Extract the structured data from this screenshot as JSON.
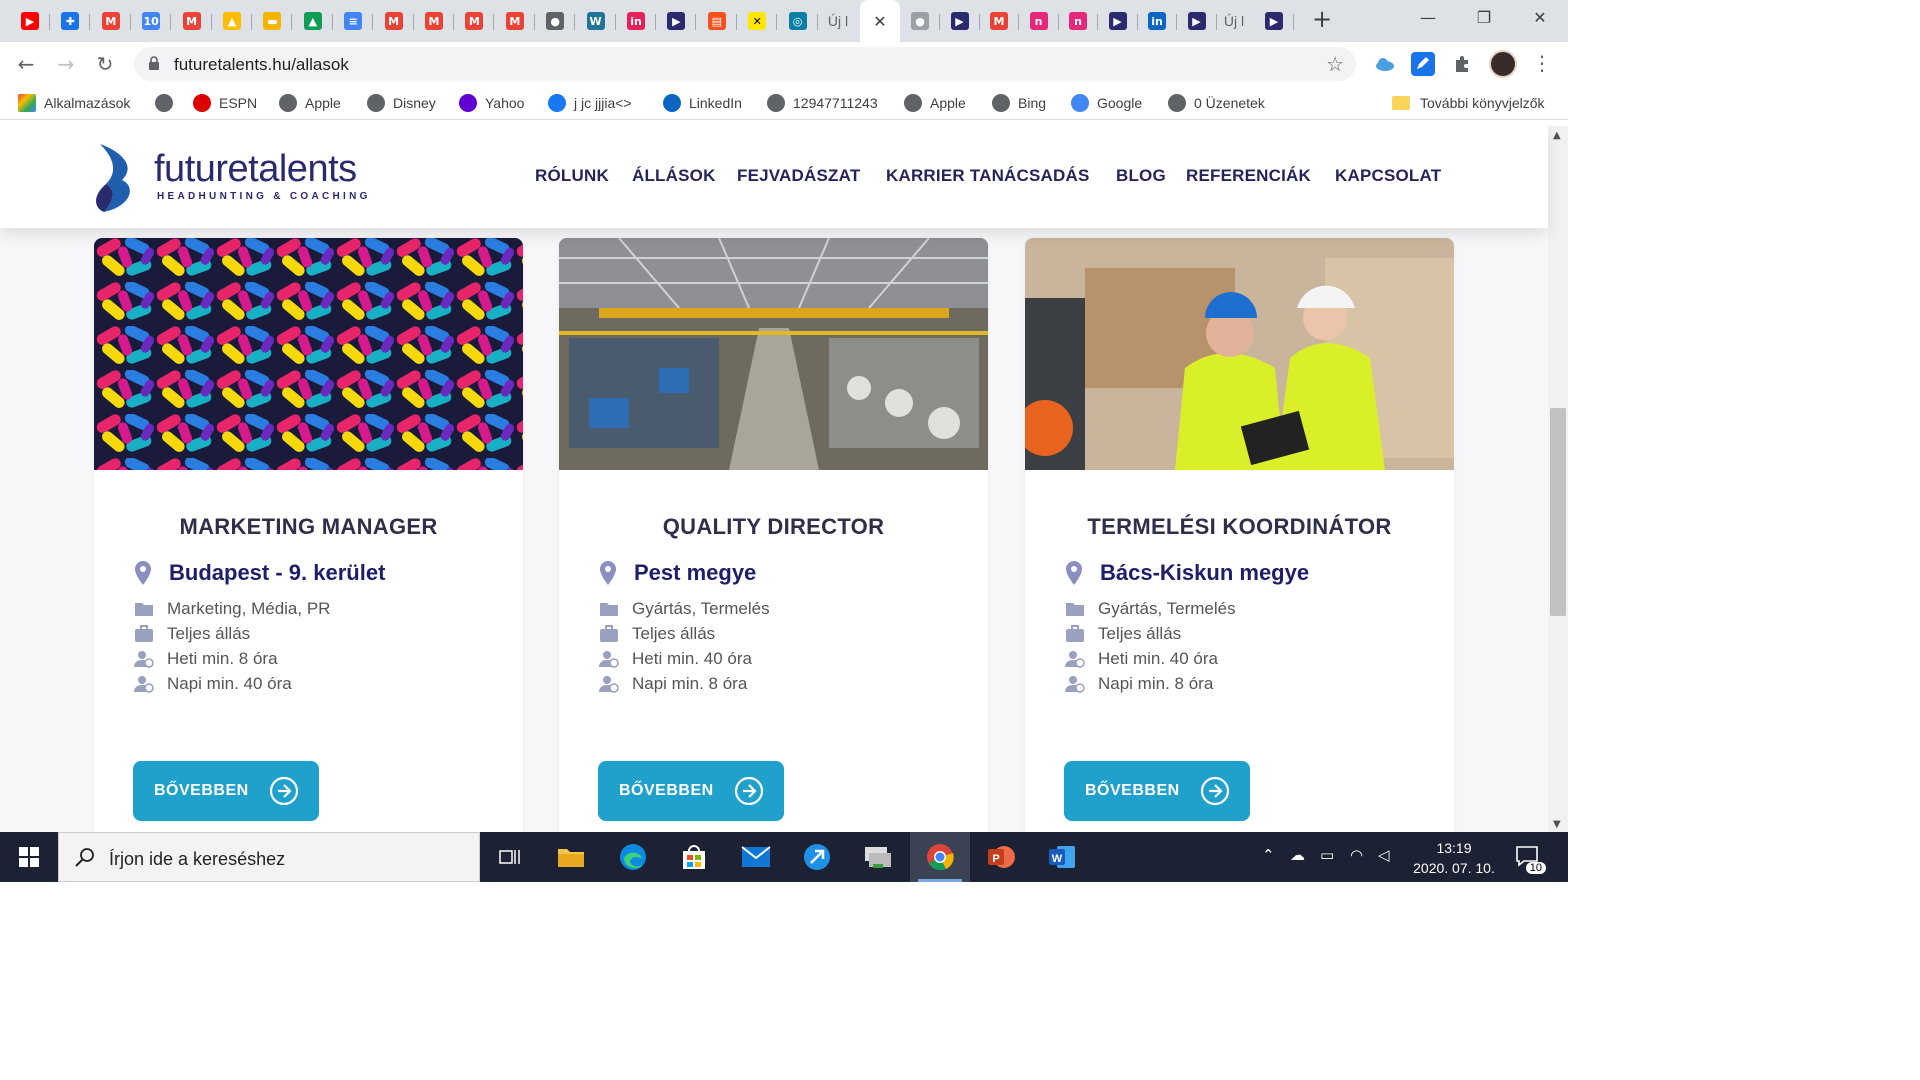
{
  "browser": {
    "tabs": [
      {
        "icon": "youtube-icon",
        "color": "#ff0000",
        "glyph": "▶"
      },
      {
        "icon": "extension-icon",
        "color": "#1a73e8",
        "glyph": "✚"
      },
      {
        "icon": "gmail-icon",
        "color": "#ea4335",
        "glyph": "M"
      },
      {
        "icon": "calendar-icon",
        "color": "#4285f4",
        "glyph": "10"
      },
      {
        "icon": "gmail-icon",
        "color": "#ea4335",
        "glyph": "M"
      },
      {
        "icon": "drive-icon",
        "color": "#fbbc04",
        "glyph": "▲"
      },
      {
        "icon": "slides-icon",
        "color": "#f4b400",
        "glyph": "▬"
      },
      {
        "icon": "drive-icon",
        "color": "#0f9d58",
        "glyph": "▲"
      },
      {
        "icon": "docs-icon",
        "color": "#4285f4",
        "glyph": "≡"
      },
      {
        "icon": "gmail-icon",
        "color": "#ea4335",
        "glyph": "M"
      },
      {
        "icon": "gmail-icon",
        "color": "#ea4335",
        "glyph": "M"
      },
      {
        "icon": "gmail-icon",
        "color": "#ea4335",
        "glyph": "M"
      },
      {
        "icon": "gmail-icon",
        "color": "#ea4335",
        "glyph": "M"
      },
      {
        "icon": "globe-icon",
        "color": "#5f6368",
        "glyph": "●"
      },
      {
        "icon": "wordpress-icon",
        "color": "#21759b",
        "glyph": "W"
      },
      {
        "icon": "invision-icon",
        "color": "#e6215a",
        "glyph": "in"
      },
      {
        "icon": "app-icon",
        "color": "#2a2a6e",
        "glyph": "▶"
      },
      {
        "icon": "document-icon",
        "color": "#f4511e",
        "glyph": "▤"
      },
      {
        "icon": "raiffeisen-icon",
        "color": "#ffe600",
        "glyph": "✕"
      },
      {
        "icon": "chat-icon",
        "color": "#0a7ea4",
        "glyph": "◎"
      }
    ],
    "tab_text_1": "Új l",
    "tabs_right": [
      {
        "icon": "globe-icon",
        "color": "#9aa0a6",
        "glyph": "●"
      },
      {
        "icon": "app-icon",
        "color": "#2a2a6e",
        "glyph": "▶"
      },
      {
        "icon": "gmail-icon",
        "color": "#ea4335",
        "glyph": "M"
      },
      {
        "icon": "app-pink-icon",
        "color": "#e6287a",
        "glyph": "n"
      },
      {
        "icon": "app-pink-icon",
        "color": "#e6287a",
        "glyph": "n"
      },
      {
        "icon": "app-icon",
        "color": "#2a2a6e",
        "glyph": "▶"
      },
      {
        "icon": "linkedin-icon",
        "color": "#0a66c2",
        "glyph": "in"
      },
      {
        "icon": "app-icon",
        "color": "#2a2a6e",
        "glyph": "▶"
      }
    ],
    "tab_text_2": "Új l",
    "tabs_end": [
      {
        "icon": "app-icon",
        "color": "#2a2a6e",
        "glyph": "▶"
      }
    ],
    "active_tab_close": "✕",
    "new_tab": "+",
    "url": "futuretalents.hu/allasok",
    "bookmarks": [
      {
        "label": "Alkalmazások",
        "icon": "apps-grid-icon",
        "color": "#ea4335"
      },
      {
        "label": "",
        "icon": "globe-icon",
        "color": "#5f6368"
      },
      {
        "label": "ESPN",
        "icon": "espn-icon",
        "color": "#d00"
      },
      {
        "label": "Apple",
        "icon": "globe-icon",
        "color": "#5f6368"
      },
      {
        "label": "Disney",
        "icon": "globe-icon",
        "color": "#5f6368"
      },
      {
        "label": "Yahoo",
        "icon": "yahoo-icon",
        "color": "#6001d2"
      },
      {
        "label": "j jc jjjia<>",
        "icon": "facebook-icon",
        "color": "#1877f2"
      },
      {
        "label": "LinkedIn",
        "icon": "linkedin-icon",
        "color": "#0a66c2"
      },
      {
        "label": "12947711243",
        "icon": "globe-icon",
        "color": "#5f6368"
      },
      {
        "label": "Apple",
        "icon": "globe-icon",
        "color": "#5f6368"
      },
      {
        "label": "Bing",
        "icon": "globe-icon",
        "color": "#5f6368"
      },
      {
        "label": "Google",
        "icon": "google-icon",
        "color": "#4285f4"
      },
      {
        "label": "0 Üzenetek",
        "icon": "globe-icon",
        "color": "#5f6368"
      }
    ],
    "more_bookmarks": "További könyvjelzők"
  },
  "site": {
    "logo_text": "futuretalents",
    "logo_tagline": "HEADHUNTING & COACHING",
    "brand_color": "#2a2a6e",
    "accent_color": "#1fa1cc",
    "nav": [
      "RÓLUNK",
      "ÁLLÁSOK",
      "FEJVADÁSZAT",
      "KARRIER TANÁCSADÁS",
      "BLOG",
      "REFERENCIÁK",
      "KAPCSOLAT"
    ]
  },
  "jobs": [
    {
      "title": "MARKETING MANAGER",
      "location": "Budapest - 9. kerület",
      "category": "Marketing, Média, PR",
      "type": "Teljes állás",
      "weekly": "Heti min. 8 óra",
      "daily": "Napi min. 40 óra",
      "button": "BŐVEBBEN",
      "image": "colorful-capsules"
    },
    {
      "title": "QUALITY DIRECTOR",
      "location": "Pest megye",
      "category": "Gyártás, Termelés",
      "type": "Teljes állás",
      "weekly": "Heti min. 40 óra",
      "daily": "Napi min. 8 óra",
      "button": "BŐVEBBEN",
      "image": "factory-hall"
    },
    {
      "title": "TERMELÉSI KOORDINÁTOR",
      "location": "Bács-Kiskun megye",
      "category": "Gyártás, Termelés",
      "type": "Teljes állás",
      "weekly": "Heti min. 40 óra",
      "daily": "Napi min. 8 óra",
      "button": "BŐVEBBEN",
      "image": "warehouse-workers"
    }
  ],
  "taskbar": {
    "search_placeholder": "Írjon ide a kereséshez",
    "time": "13:19",
    "date": "2020. 07. 10.",
    "notifications": "10"
  }
}
